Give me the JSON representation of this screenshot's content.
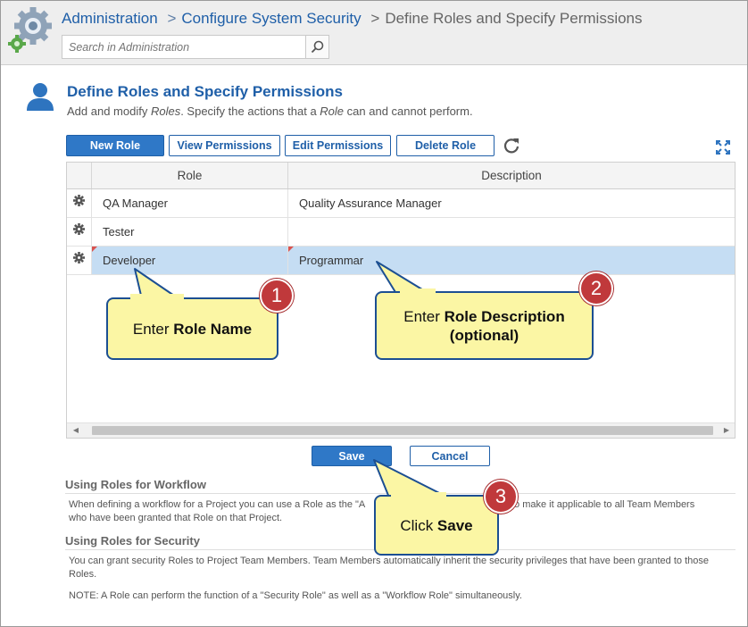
{
  "breadcrumb": {
    "items": [
      "Administration",
      "Configure System Security"
    ],
    "separator": ">",
    "current": "Define Roles and Specify Permissions"
  },
  "search": {
    "placeholder": "Search in Administration"
  },
  "page": {
    "title": "Define Roles and Specify Permissions",
    "subtitle_parts": [
      "Add and modify ",
      "Roles",
      ". Specify the actions that a ",
      "Role",
      " can and cannot perform."
    ]
  },
  "toolbar": {
    "new_role": "New Role",
    "view_permissions": "View Permissions",
    "edit_permissions": "Edit Permissions",
    "delete_role": "Delete Role"
  },
  "grid": {
    "columns": [
      "Role",
      "Description"
    ],
    "rows": [
      {
        "role": "QA Manager",
        "description": "Quality Assurance Manager",
        "selected": false
      },
      {
        "role": "Tester",
        "description": "",
        "selected": false
      },
      {
        "role": "Developer",
        "description": "Programmar",
        "selected": true
      }
    ]
  },
  "actions": {
    "save": "Save",
    "cancel": "Cancel"
  },
  "help": {
    "workflow_title": "Using Roles for Workflow",
    "workflow_line1": "When defining a workflow for a Project you can use a Role as the \"A",
    "workflow_line1_end": "ser) to make it applicable to all Team Members",
    "workflow_line2": "who have been granted that Role on that Project.",
    "security_title": "Using Roles for Security",
    "security_text": "You can grant security Roles to Project Team Members. Team Members automatically inherit the security privileges that have been granted to those Roles.",
    "note": "NOTE: A Role can perform the function of a \"Security Role\" as well as a \"Workflow Role\" simultaneously."
  },
  "callouts": [
    {
      "number": "1",
      "prefix": "Enter ",
      "bold": "Role Name",
      "suffix": ""
    },
    {
      "number": "2",
      "prefix": "Enter ",
      "bold": "Role Description",
      "suffix": "(optional)"
    },
    {
      "number": "3",
      "prefix": "Click ",
      "bold": "Save",
      "suffix": ""
    }
  ],
  "colors": {
    "link": "#1f5fa8",
    "primary_button": "#2f78c7",
    "selected_row": "#c5ddf3",
    "callout_fill": "#fbf6a4",
    "callout_border": "#1c4f92",
    "badge": "#c0393b"
  },
  "icons": [
    "admin-gears-icon",
    "search-icon",
    "user-icon",
    "refresh-icon",
    "expand-icon",
    "gear-icon"
  ]
}
